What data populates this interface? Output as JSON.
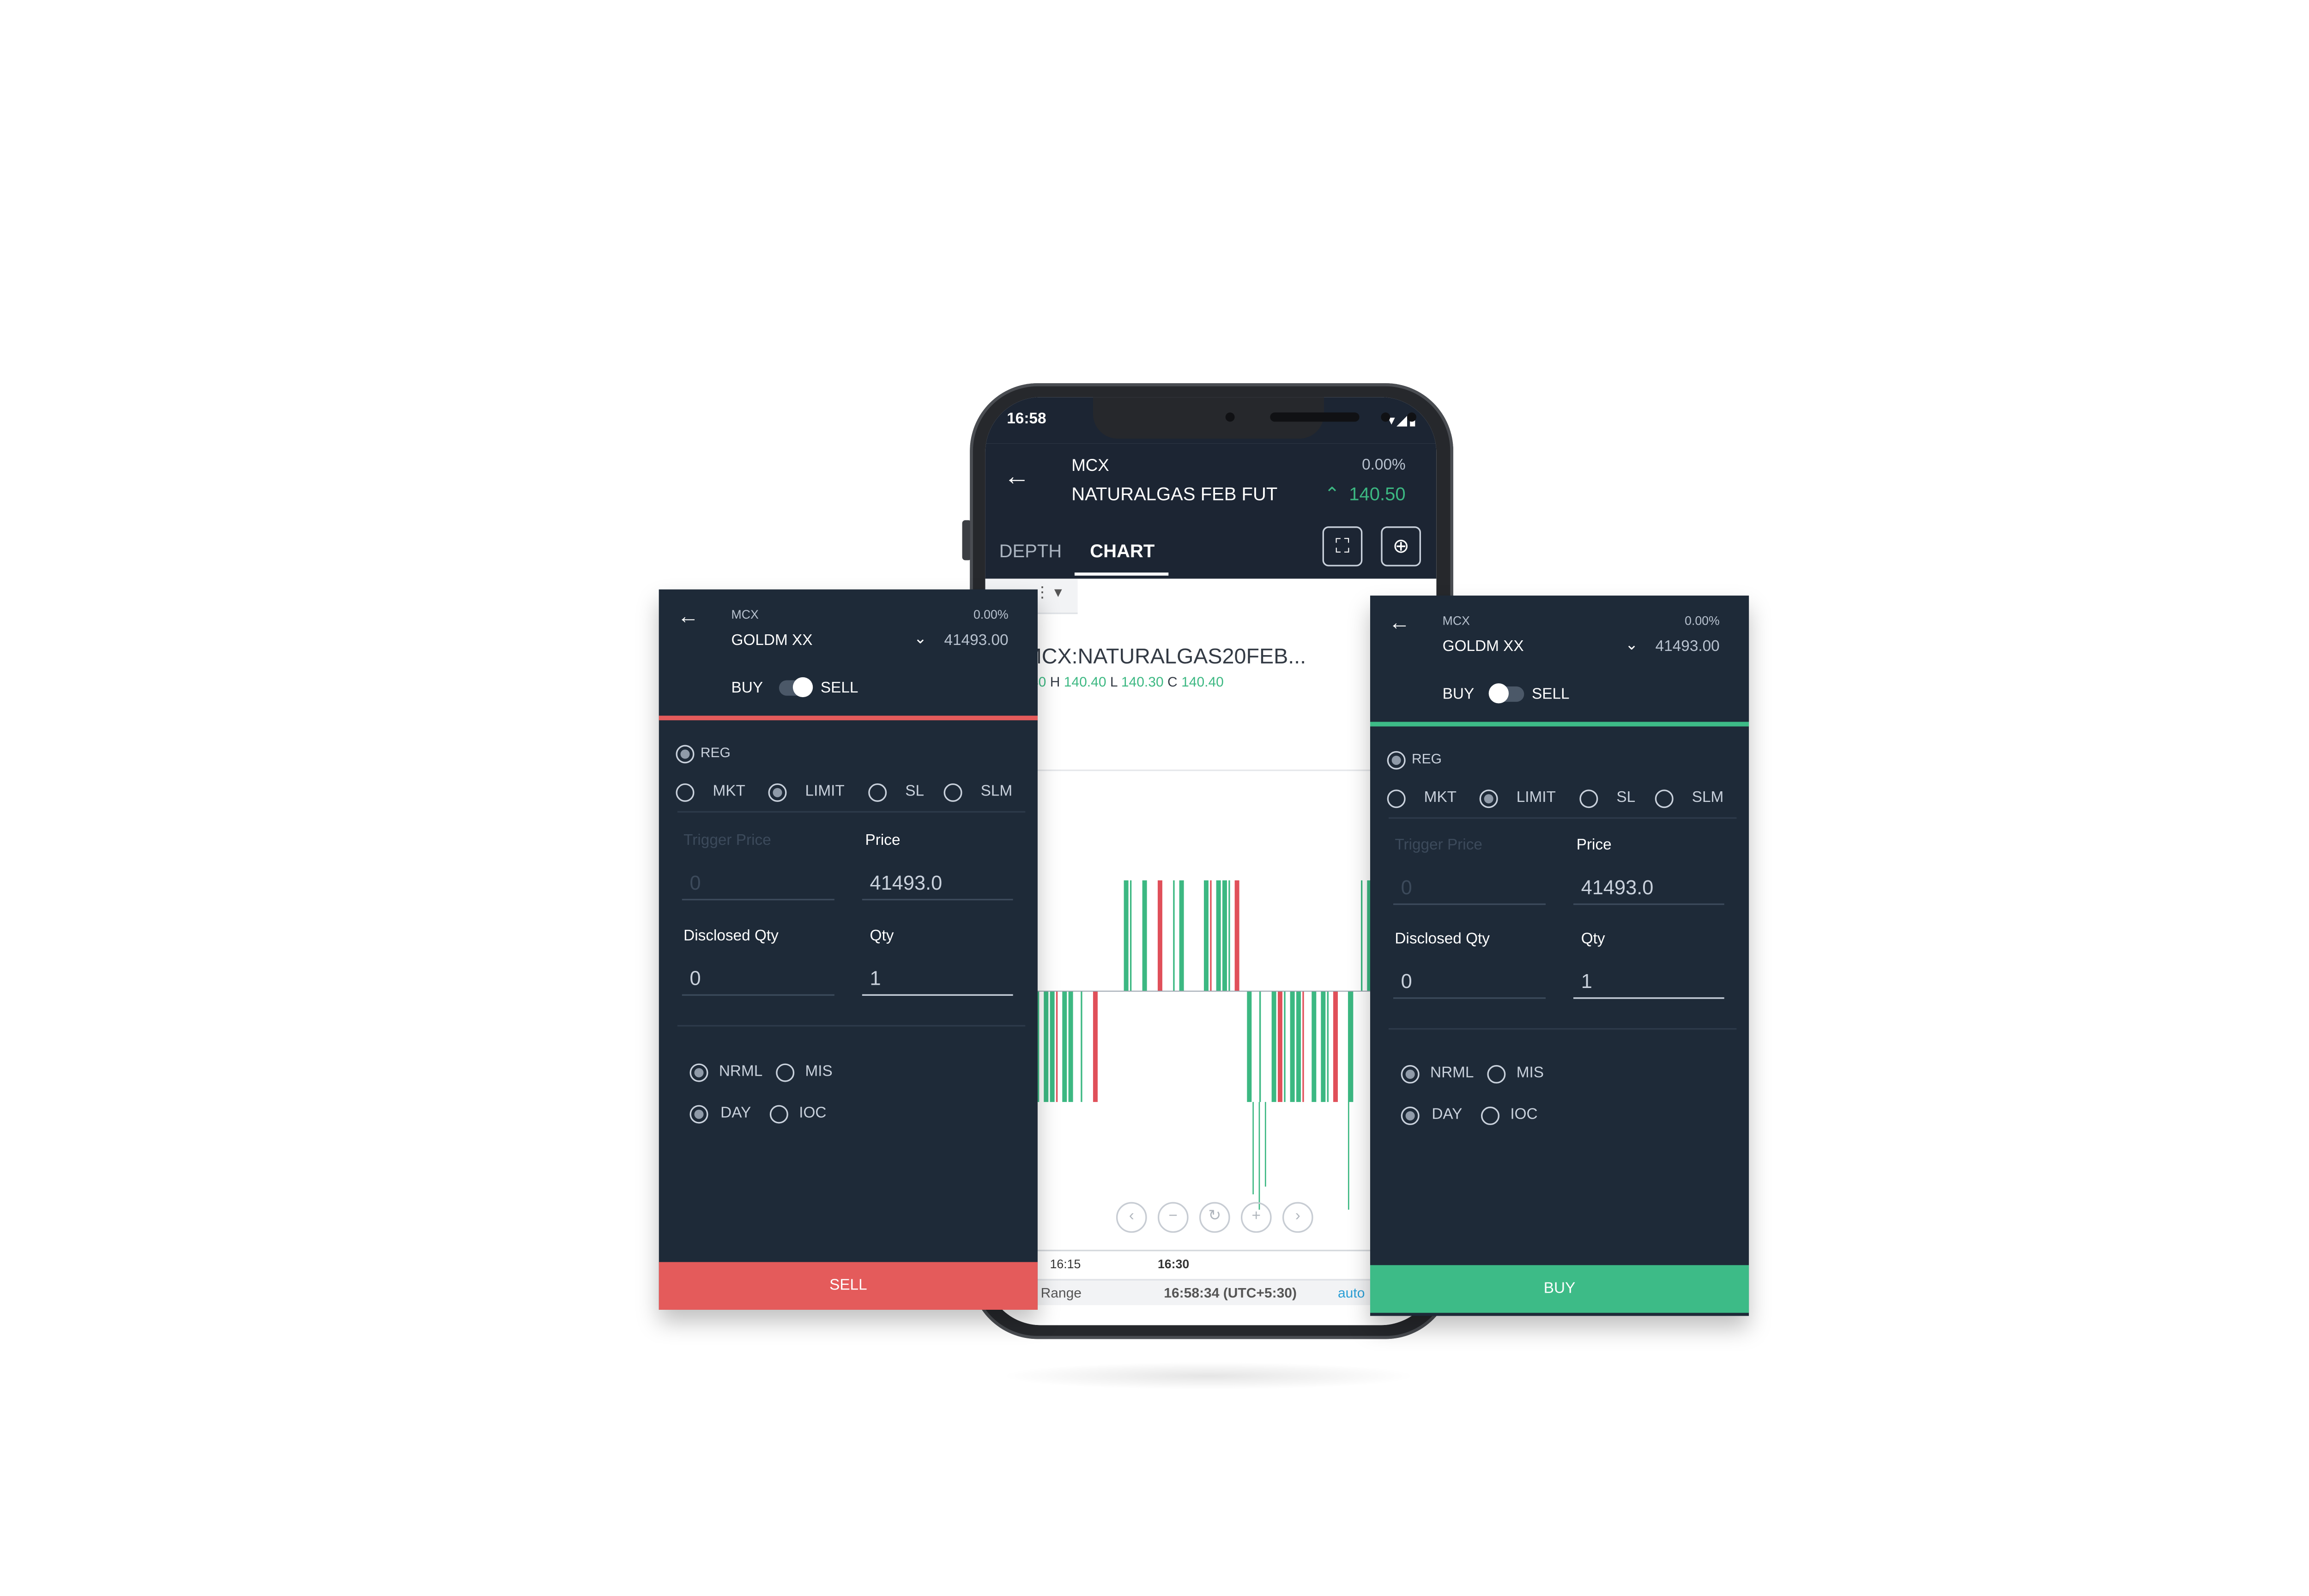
{
  "phone": {
    "status_time": "16:58",
    "exchange": "MCX",
    "symbol": "NATURALGAS FEB FUT",
    "change_pct": "0.00%",
    "ltp": "140.50",
    "tabs": [
      "DEPTH",
      "CHART"
    ],
    "active_tab": "CHART",
    "chart": {
      "symbol": "MCX:NATURALGAS20FEB...",
      "ohlc_o": ".40",
      "ohlc_h_label": "H",
      "ohlc_h": "140.40",
      "ohlc_l_label": "L",
      "ohlc_l": "140.30",
      "ohlc_c_label": "C",
      "ohlc_c": "140.40",
      "time_ticks": [
        "16:15",
        "16:30"
      ],
      "range_label": "Range",
      "clock": "16:58:34 (UTC+5:30)",
      "auto_label": "auto",
      "colors": {
        "up": "#3cb882",
        "down": "#e0505a"
      }
    }
  },
  "sell_panel": {
    "exchange": "MCX",
    "change_pct": "0.00%",
    "symbol": "GOLDM XX",
    "ltp": "41493.00",
    "buy_label": "BUY",
    "sell_label": "SELL",
    "mode": "SELL",
    "variety": "REG",
    "order_types": [
      "MKT",
      "LIMIT",
      "SL",
      "SLM"
    ],
    "selected_order_type": "LIMIT",
    "trigger_price_label": "Trigger Price",
    "trigger_price_value": "0",
    "price_label": "Price",
    "price_value": "41493.0",
    "disclosed_qty_label": "Disclosed Qty",
    "disclosed_qty_value": "0",
    "qty_label": "Qty",
    "qty_value": "1",
    "product_options": [
      "NRML",
      "MIS"
    ],
    "selected_product": "NRML",
    "validity_options": [
      "DAY",
      "IOC"
    ],
    "selected_validity": "DAY",
    "action_label": "SELL",
    "accent": "#e45b5b"
  },
  "buy_panel": {
    "exchange": "MCX",
    "change_pct": "0.00%",
    "symbol": "GOLDM XX",
    "ltp": "41493.00",
    "buy_label": "BUY",
    "sell_label": "SELL",
    "mode": "BUY",
    "variety": "REG",
    "order_types": [
      "MKT",
      "LIMIT",
      "SL",
      "SLM"
    ],
    "selected_order_type": "LIMIT",
    "trigger_price_label": "Trigger Price",
    "trigger_price_value": "0",
    "price_label": "Price",
    "price_value": "41493.0",
    "disclosed_qty_label": "Disclosed Qty",
    "disclosed_qty_value": "0",
    "qty_label": "Qty",
    "qty_value": "1",
    "product_options": [
      "NRML",
      "MIS"
    ],
    "selected_product": "NRML",
    "validity_options": [
      "DAY",
      "IOC"
    ],
    "selected_validity": "DAY",
    "action_label": "BUY",
    "accent": "#3dbb87"
  }
}
